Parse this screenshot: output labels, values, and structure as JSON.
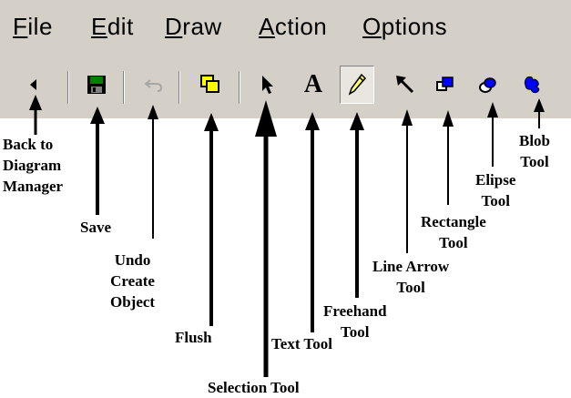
{
  "menu": [
    {
      "mnemonic": "F",
      "rest": "ile"
    },
    {
      "mnemonic": "E",
      "rest": "dit"
    },
    {
      "mnemonic": "D",
      "rest": "raw"
    },
    {
      "mnemonic": "A",
      "rest": "ction"
    },
    {
      "mnemonic": "O",
      "rest": "ptions"
    }
  ],
  "toolbar": {
    "icons": [
      "back-icon",
      "save-icon",
      "undo-icon",
      "flush-icon",
      "selection-icon",
      "text-icon",
      "freehand-icon",
      "line-arrow-icon",
      "rectangle-icon",
      "ellipse-icon",
      "blob-icon"
    ],
    "text_tool_glyph": "A",
    "freehand_pressed": true
  },
  "colors": {
    "chrome": "#d4d0c8",
    "accent_blue": "#0000ff",
    "save_green": "#008000",
    "flush_yellow": "#ffff00"
  },
  "callouts": {
    "back": [
      "Back to",
      "Diagram",
      "Manager"
    ],
    "save": "Save",
    "undo": [
      "Undo",
      "Create",
      "Object"
    ],
    "flush": "Flush",
    "selection": "Selection Tool",
    "text": "Text Tool",
    "freehand": [
      "Freehand",
      "Tool"
    ],
    "line_arrow": [
      "Line Arrow",
      "Tool"
    ],
    "rectangle": [
      "Rectangle",
      "Tool"
    ],
    "ellipse": [
      "Elipse",
      "Tool"
    ],
    "blob": [
      "Blob",
      "Tool"
    ]
  }
}
